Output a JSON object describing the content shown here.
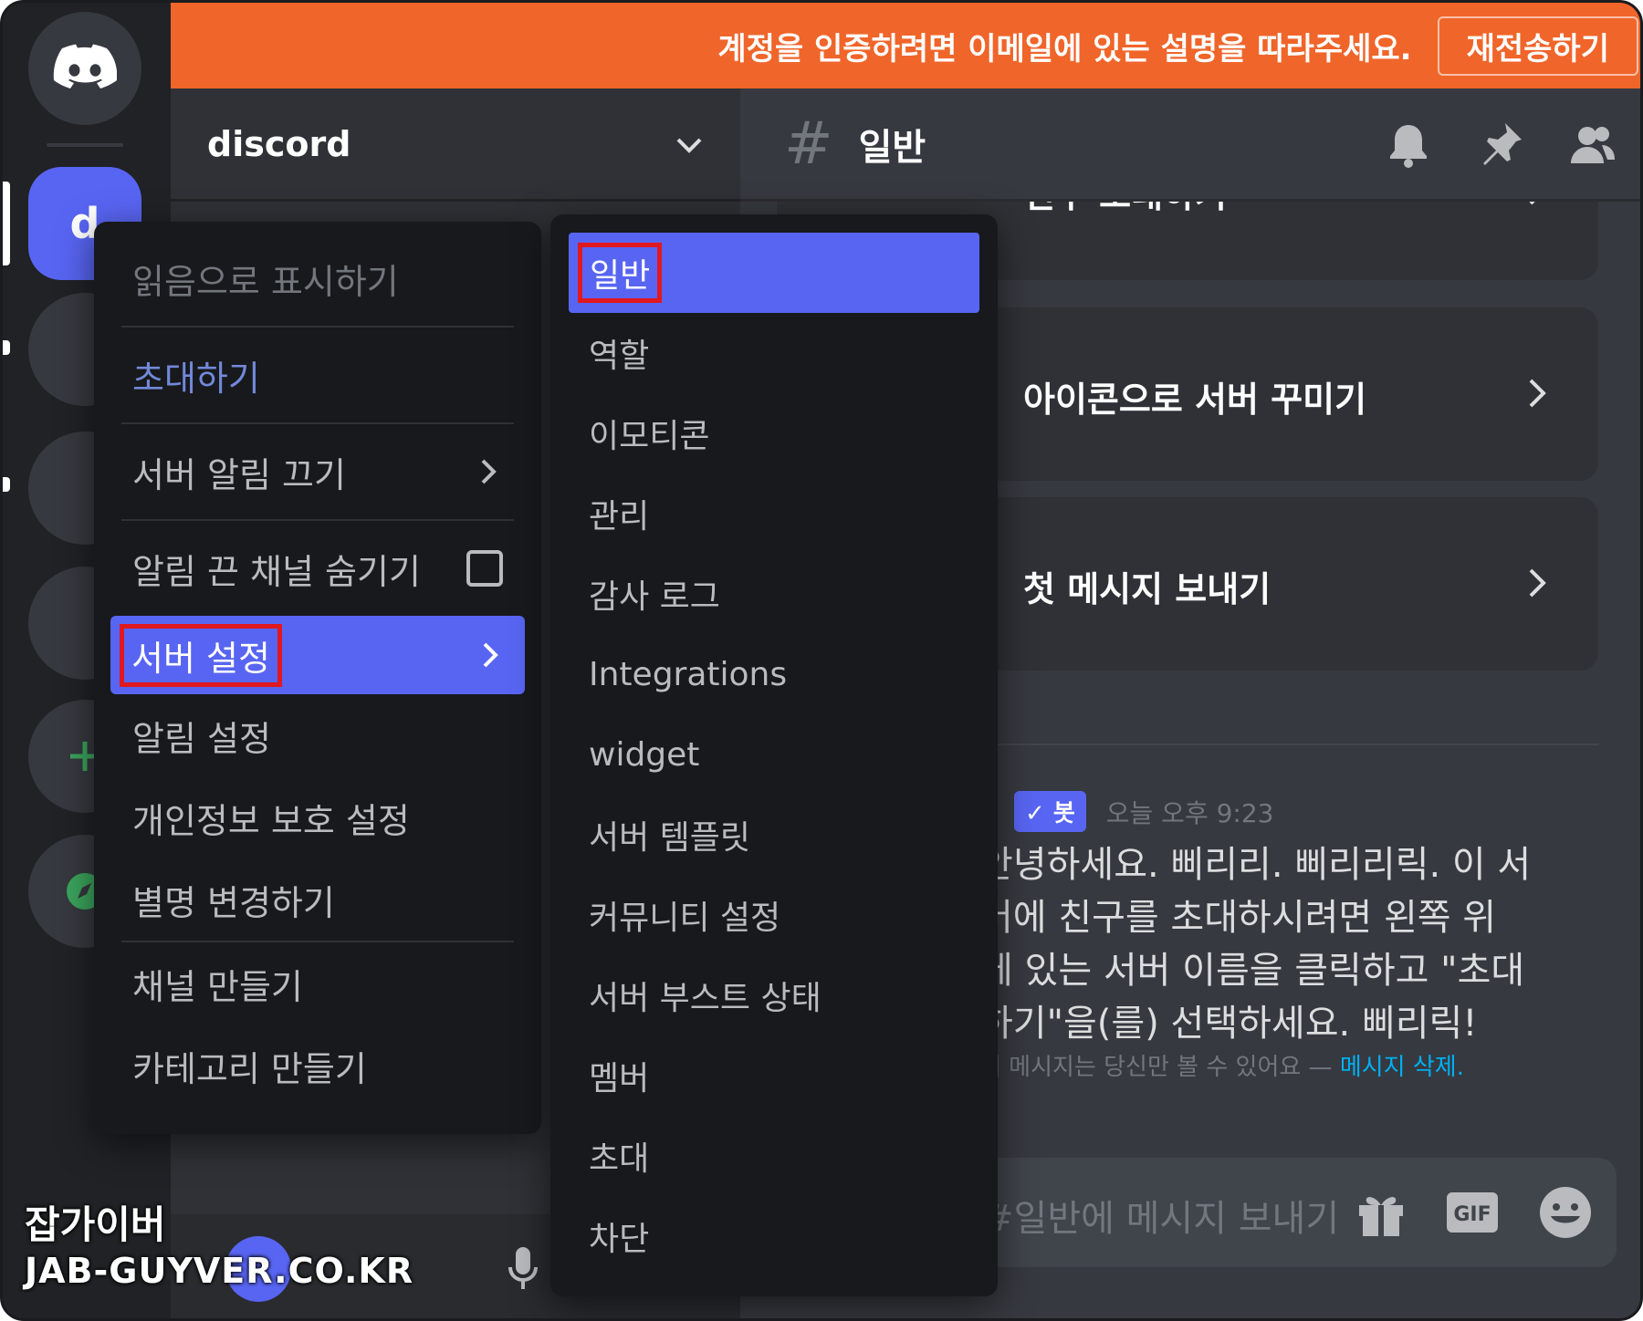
{
  "banner": {
    "text": "계정을 인증하려면 이메일에 있는 설명을 따라주세요.",
    "resend_label": "재전송하기"
  },
  "rail": {
    "server_initial": "d"
  },
  "server": {
    "name": "discord"
  },
  "channel": {
    "hash": "#",
    "name": "일반"
  },
  "cards": [
    {
      "text": "친구 초대하기"
    },
    {
      "text": "아이콘으로 서버 꾸미기"
    },
    {
      "text": "첫 메시지 보내기"
    }
  ],
  "message": {
    "badge": "✓ 봇",
    "time": "오늘 오후 9:23",
    "lines": [
      "안녕하세요. 삐리리. 삐리리릭. 이 서",
      "버에 친구를 초대하시려면 왼쪽 위",
      "에 있는 서버 이름을 클릭하고 \"초대",
      "하기\"을(를) 선택하세요. 삐리릭!"
    ],
    "ephemeral": "이 메시지는 당신만 볼 수 있어요 —",
    "delete_link": "메시지 삭제."
  },
  "composer": {
    "placeholder": "#일반에 메시지 보내기"
  },
  "menu_main": {
    "items": [
      {
        "label": "읽음으로 표시하기"
      },
      {
        "label": "초대하기"
      },
      {
        "label": "서버 알림 끄기"
      },
      {
        "label": "알림 끈 채널 숨기기"
      },
      {
        "label": "서버 설정"
      },
      {
        "label": "알림 설정"
      },
      {
        "label": "개인정보 보호 설정"
      },
      {
        "label": "별명 변경하기"
      },
      {
        "label": "채널 만들기"
      },
      {
        "label": "카테고리 만들기"
      }
    ]
  },
  "menu_sub": {
    "items": [
      {
        "label": "일반"
      },
      {
        "label": "역할"
      },
      {
        "label": "이모티콘"
      },
      {
        "label": "관리"
      },
      {
        "label": "감사 로그"
      },
      {
        "label": "Integrations"
      },
      {
        "label": "widget"
      },
      {
        "label": "서버 템플릿"
      },
      {
        "label": "커뮤니티 설정"
      },
      {
        "label": "서버 부스트 상태"
      },
      {
        "label": "멤버"
      },
      {
        "label": "초대"
      },
      {
        "label": "차단"
      }
    ]
  },
  "watermark": {
    "line1": "잡가이버",
    "line2": "JAB-GUYVER.CO.KR"
  },
  "colors": {
    "banner": "#f0652a",
    "blurple": "#5865f2",
    "highlight": "#e0181f"
  }
}
